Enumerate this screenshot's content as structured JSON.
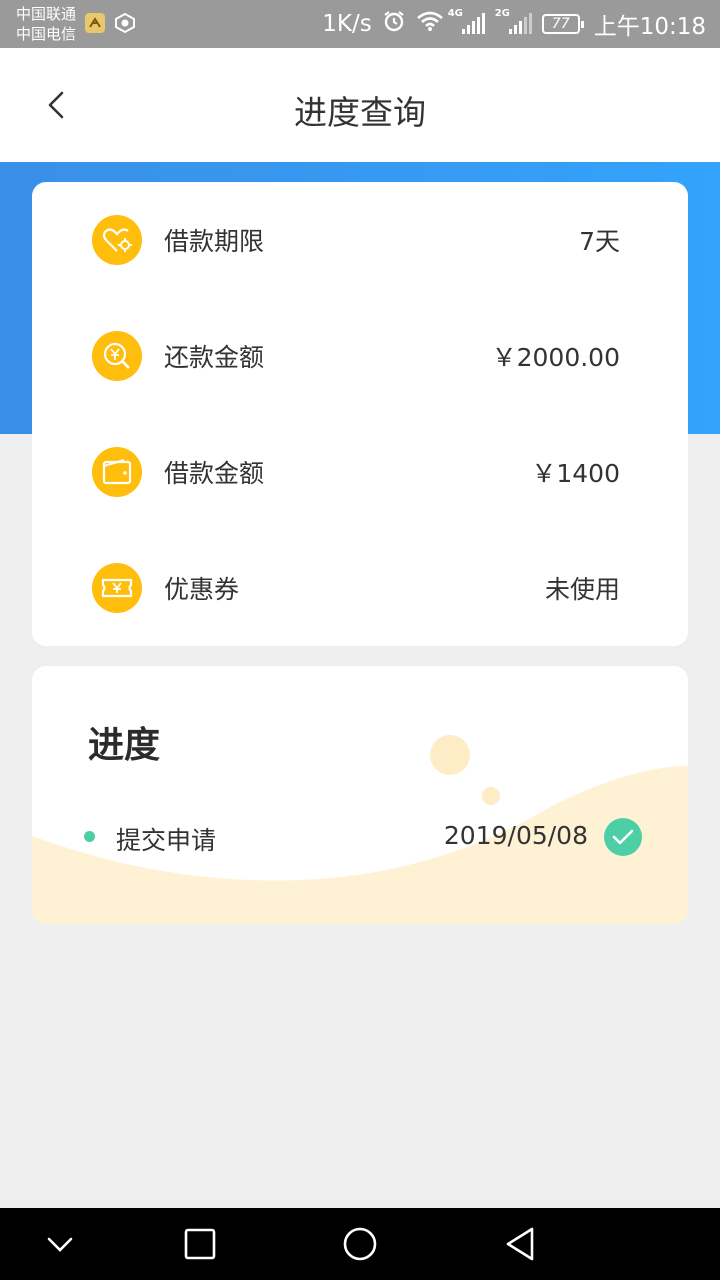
{
  "status_bar": {
    "carrier1": "中国联通",
    "carrier2": "中国电信",
    "speed": "1K/s",
    "net1": "4G",
    "net2": "2G",
    "battery": "77",
    "time": "上午10:18"
  },
  "header": {
    "title": "进度查询"
  },
  "loan_info": [
    {
      "label": "借款期限",
      "value": "7天",
      "icon": "heart-gear-icon"
    },
    {
      "label": "还款金额",
      "value": "￥2000.00",
      "icon": "yuan-search-icon"
    },
    {
      "label": "借款金额",
      "value": "￥1400",
      "icon": "wallet-icon"
    },
    {
      "label": "优惠券",
      "value": "未使用",
      "icon": "coupon-icon"
    }
  ],
  "progress": {
    "title": "进度",
    "steps": [
      {
        "label": "提交申请",
        "date": "2019/05/08",
        "done": true
      }
    ]
  },
  "colors": {
    "accent_blue": "#3a8fe8",
    "icon_yellow": "#ffbe0b",
    "success_green": "#4ccfa4",
    "wave_cream": "#fff2d4"
  }
}
